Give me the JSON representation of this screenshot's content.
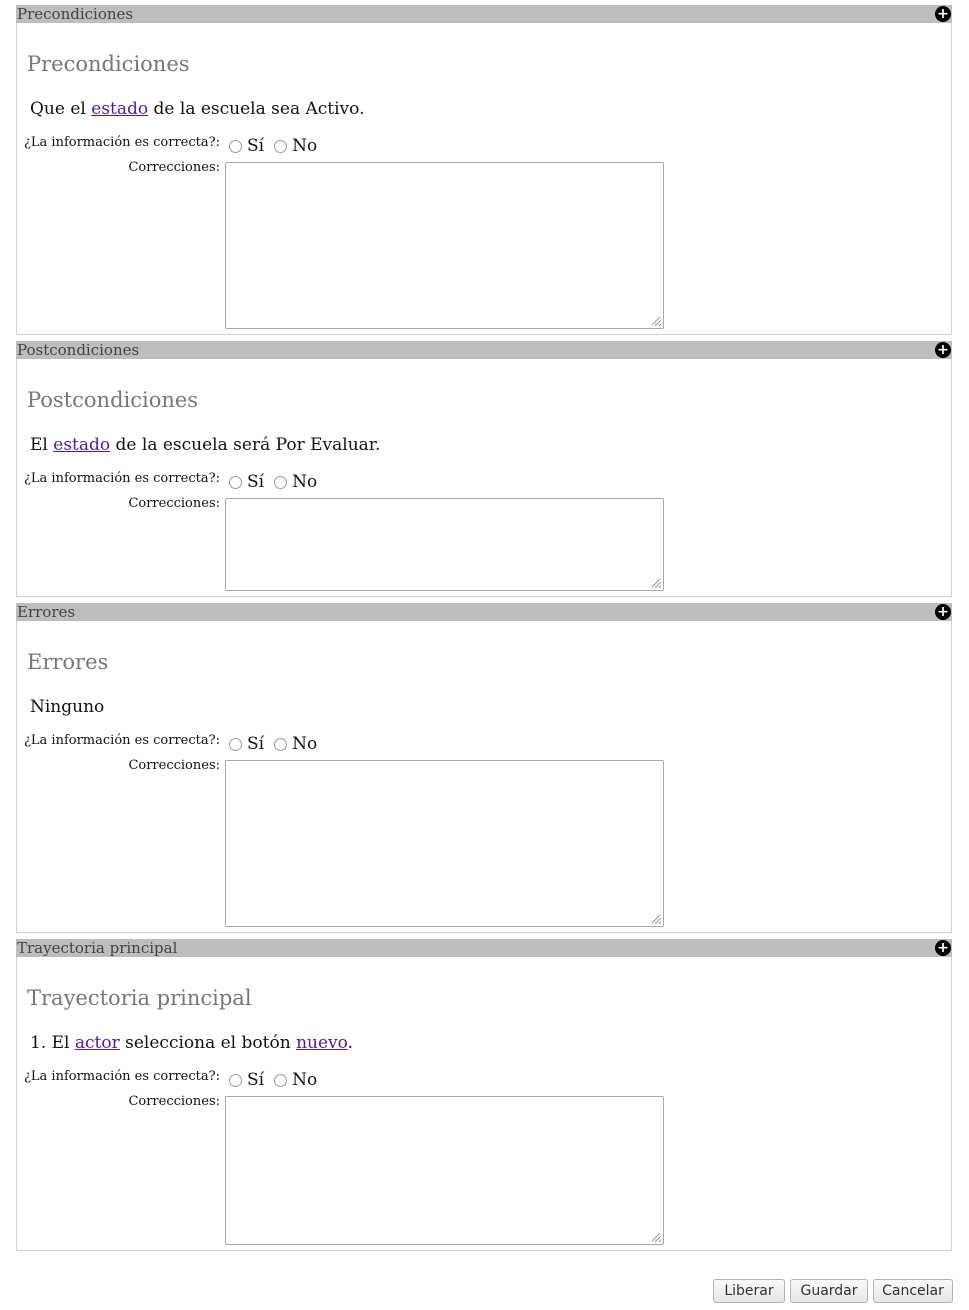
{
  "common": {
    "question": "¿La información es correcta?:",
    "yes": "Sí",
    "no": "No",
    "corrections": "Correcciones:"
  },
  "sections": [
    {
      "bar_title": "Precondiciones",
      "heading": "Precondiciones",
      "text_parts": [
        "Que el ",
        "estado",
        " de la escuela sea Activo."
      ]
    },
    {
      "bar_title": "Postcondiciones",
      "heading": "Postcondiciones",
      "text_parts": [
        "El ",
        "estado",
        " de la escuela será Por Evaluar."
      ]
    },
    {
      "bar_title": "Errores",
      "heading": "Errores",
      "text_parts": [
        "Ninguno"
      ]
    },
    {
      "bar_title": "Trayectoria principal",
      "heading": "Trayectoria principal",
      "text_parts": [
        "1. El ",
        "actor",
        " selecciona el botón ",
        "nuevo",
        "."
      ]
    }
  ],
  "buttons": {
    "release": "Liberar",
    "save": "Guardar",
    "cancel": "Cancelar"
  },
  "icons": {
    "expand": "plus-circle-icon"
  }
}
